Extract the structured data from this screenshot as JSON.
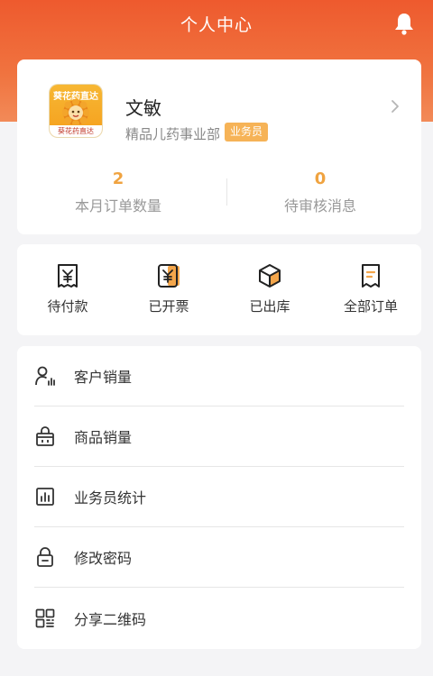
{
  "header": {
    "title": "个人中心"
  },
  "profile": {
    "avatar_brand_top": "葵花药直达",
    "avatar_brand_bottom": "葵花药直达",
    "name": "文敏",
    "department": "精品儿药事业部",
    "role_badge": "业务员"
  },
  "stats": [
    {
      "value": "2",
      "label": "本月订单数量"
    },
    {
      "value": "0",
      "label": "待审核消息"
    }
  ],
  "orders": [
    {
      "label": "待付款",
      "icon": "yuan-receipt-icon"
    },
    {
      "label": "已开票",
      "icon": "invoice-icon"
    },
    {
      "label": "已出库",
      "icon": "box-icon"
    },
    {
      "label": "全部订单",
      "icon": "order-list-icon"
    }
  ],
  "menu": [
    {
      "label": "客户销量",
      "icon": "customer-sales-icon"
    },
    {
      "label": "商品销量",
      "icon": "basket-icon"
    },
    {
      "label": "业务员统计",
      "icon": "bar-chart-icon"
    },
    {
      "label": "修改密码",
      "icon": "lock-icon"
    },
    {
      "label": "分享二维码",
      "icon": "qr-code-icon"
    }
  ],
  "colors": {
    "header_gradient_start": "#ee5a2e",
    "header_gradient_end": "#f28a58",
    "badge": "#f6b357",
    "stat_number": "#f0a340",
    "icon_accent": "#f4a64b"
  }
}
